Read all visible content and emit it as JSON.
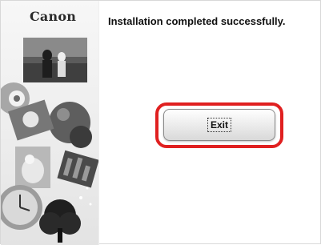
{
  "app": {
    "logo_text": "Canon"
  },
  "main": {
    "message": "Installation completed successfully."
  },
  "actions": {
    "exit_label": "Exit"
  },
  "colors": {
    "highlight": "#e02020",
    "background": "#ffffff"
  }
}
